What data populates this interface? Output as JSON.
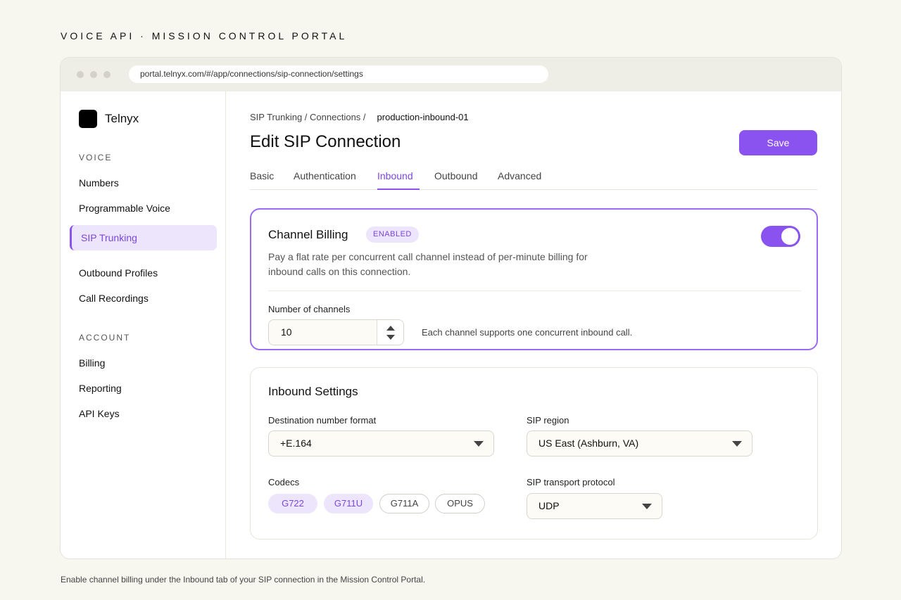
{
  "eyebrow": "VOICE API · MISSION CONTROL PORTAL",
  "browser": {
    "url": "portal.telnyx.com/#/app/connections/sip-connection/settings"
  },
  "sidebar": {
    "brand": "Telnyx",
    "sections": [
      {
        "title": "VOICE",
        "items": [
          "Numbers",
          "Programmable Voice",
          "SIP Trunking",
          "Outbound Profiles",
          "Call Recordings"
        ]
      },
      {
        "title": "ACCOUNT",
        "items": [
          "Billing",
          "Reporting",
          "API Keys"
        ]
      }
    ],
    "active_item": "SIP Trunking"
  },
  "header": {
    "breadcrumb_parent": "SIP Trunking / Connections /",
    "breadcrumb_current": "production-inbound-01",
    "title": "Edit SIP Connection",
    "save_label": "Save"
  },
  "tabs": [
    {
      "label": "Basic",
      "active": false
    },
    {
      "label": "Authentication",
      "active": false
    },
    {
      "label": "Inbound",
      "active": true
    },
    {
      "label": "Outbound",
      "active": false
    },
    {
      "label": "Advanced",
      "active": false
    }
  ],
  "channel_billing": {
    "title": "Channel Billing",
    "badge": "ENABLED",
    "description": "Pay a flat rate per concurrent call channel instead of per-minute billing for inbound calls on this connection.",
    "toggle_on": true,
    "channels_label": "Number of channels",
    "channels_value": "10",
    "hint": "Each channel supports one concurrent inbound call."
  },
  "inbound_settings": {
    "title": "Inbound Settings",
    "destination_label": "Destination number format",
    "destination_value": "+E.164",
    "region_label": "SIP region",
    "region_value": "US East (Ashburn, VA)",
    "codecs_label": "Codecs",
    "codecs": [
      {
        "name": "G722",
        "selected": true
      },
      {
        "name": "G711U",
        "selected": true
      },
      {
        "name": "G711A",
        "selected": false
      },
      {
        "name": "OPUS",
        "selected": false
      }
    ],
    "transport_label": "SIP transport protocol",
    "transport_value": "UDP"
  },
  "footnote": "Enable channel billing under the Inbound tab of your SIP connection in the Mission Control Portal.",
  "colors": {
    "accent": "#8a52ee",
    "accent_soft": "#ece5fb",
    "background": "#f8f7ef"
  },
  "icons": [
    "window-dot-icon",
    "brand-logo-icon",
    "stepper-up-icon",
    "stepper-down-icon",
    "chevron-down-icon"
  ]
}
